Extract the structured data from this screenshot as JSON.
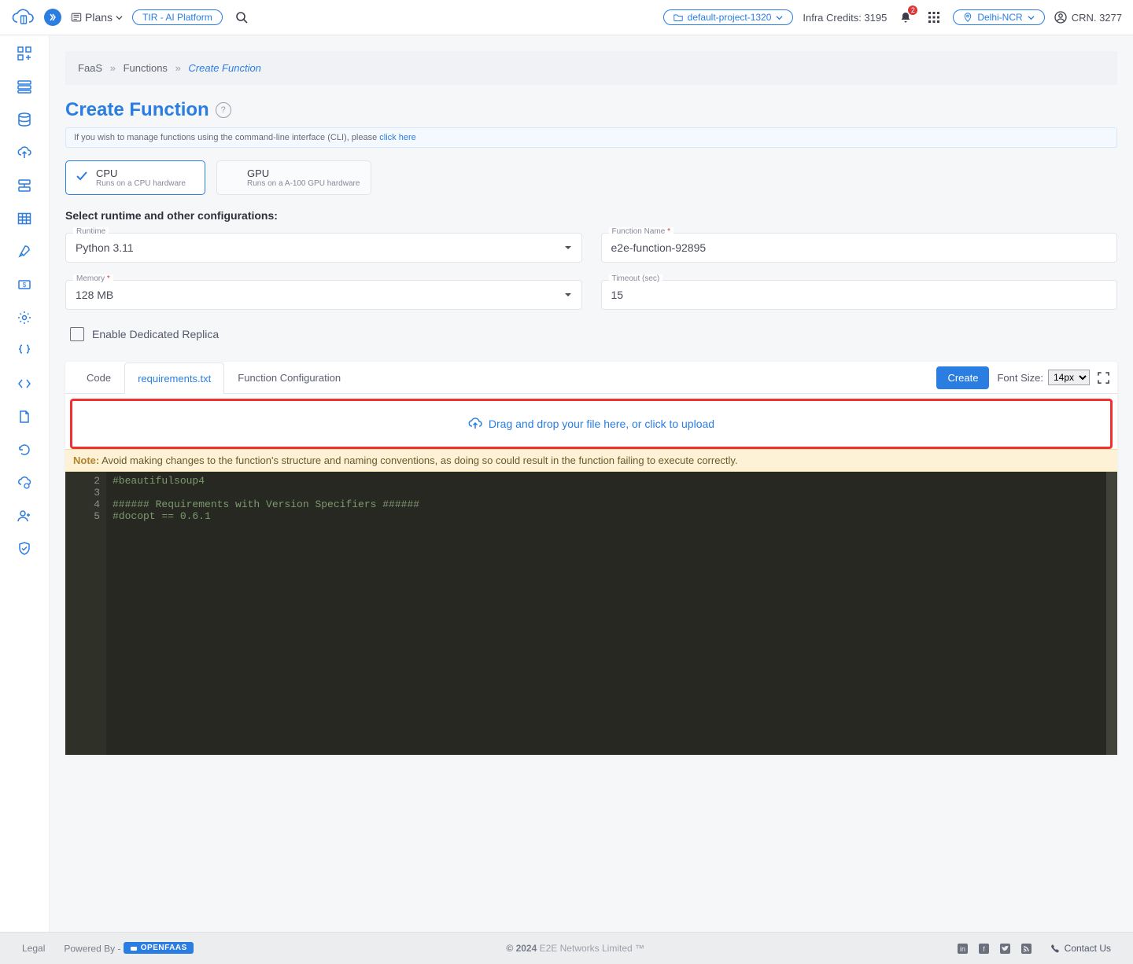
{
  "topbar": {
    "plans_label": "Plans",
    "tir_label": "TIR - AI Platform",
    "project_label": "default-project-1320",
    "credits_label": "Infra Credits: 3195",
    "notif_badge": "2",
    "region_label": "Delhi-NCR",
    "crn_label": "CRN. 3277"
  },
  "breadcrumb": {
    "a": "FaaS",
    "b": "Functions",
    "c": "Create Function"
  },
  "page": {
    "title": "Create Function",
    "cli_text": "If you wish to manage functions using the command-line interface (CLI), please ",
    "cli_link": "click here"
  },
  "hw": {
    "cpu_title": "CPU",
    "cpu_sub": "Runs on a CPU hardware",
    "gpu_title": "GPU",
    "gpu_sub": "Runs on a A-100 GPU hardware"
  },
  "section_label": "Select runtime and other configurations:",
  "form": {
    "runtime_label": "Runtime",
    "runtime_value": "Python 3.11",
    "name_label": "Function Name",
    "name_value": "e2e-function-92895",
    "memory_label": "Memory",
    "memory_value": "128 MB",
    "timeout_label": "Timeout (sec)",
    "timeout_value": "15",
    "replica_label": "Enable Dedicated Replica"
  },
  "tabs": {
    "code": "Code",
    "req": "requirements.txt",
    "cfg": "Function Configuration",
    "create": "Create",
    "fontsize_label": "Font Size:",
    "fontsize_value": "14px"
  },
  "dropzone": "Drag and drop your file here, or click to upload",
  "note": {
    "lead": "Note:",
    "text": " Avoid making changes to the function's structure and naming conventions, as doing so could result in the function failing to execute correctly."
  },
  "code": {
    "gutter": [
      "2",
      "3",
      "4",
      "5"
    ],
    "lines": [
      "#beautifulsoup4",
      "",
      "###### Requirements with Version Specifiers ######",
      "#docopt == 0.6.1"
    ]
  },
  "footer": {
    "legal": "Legal",
    "powered": "Powered By -",
    "openfaas": "OPENFAAS",
    "copy": "© 2024 ",
    "company": "E2E Networks Limited ™",
    "contact": "Contact Us"
  }
}
